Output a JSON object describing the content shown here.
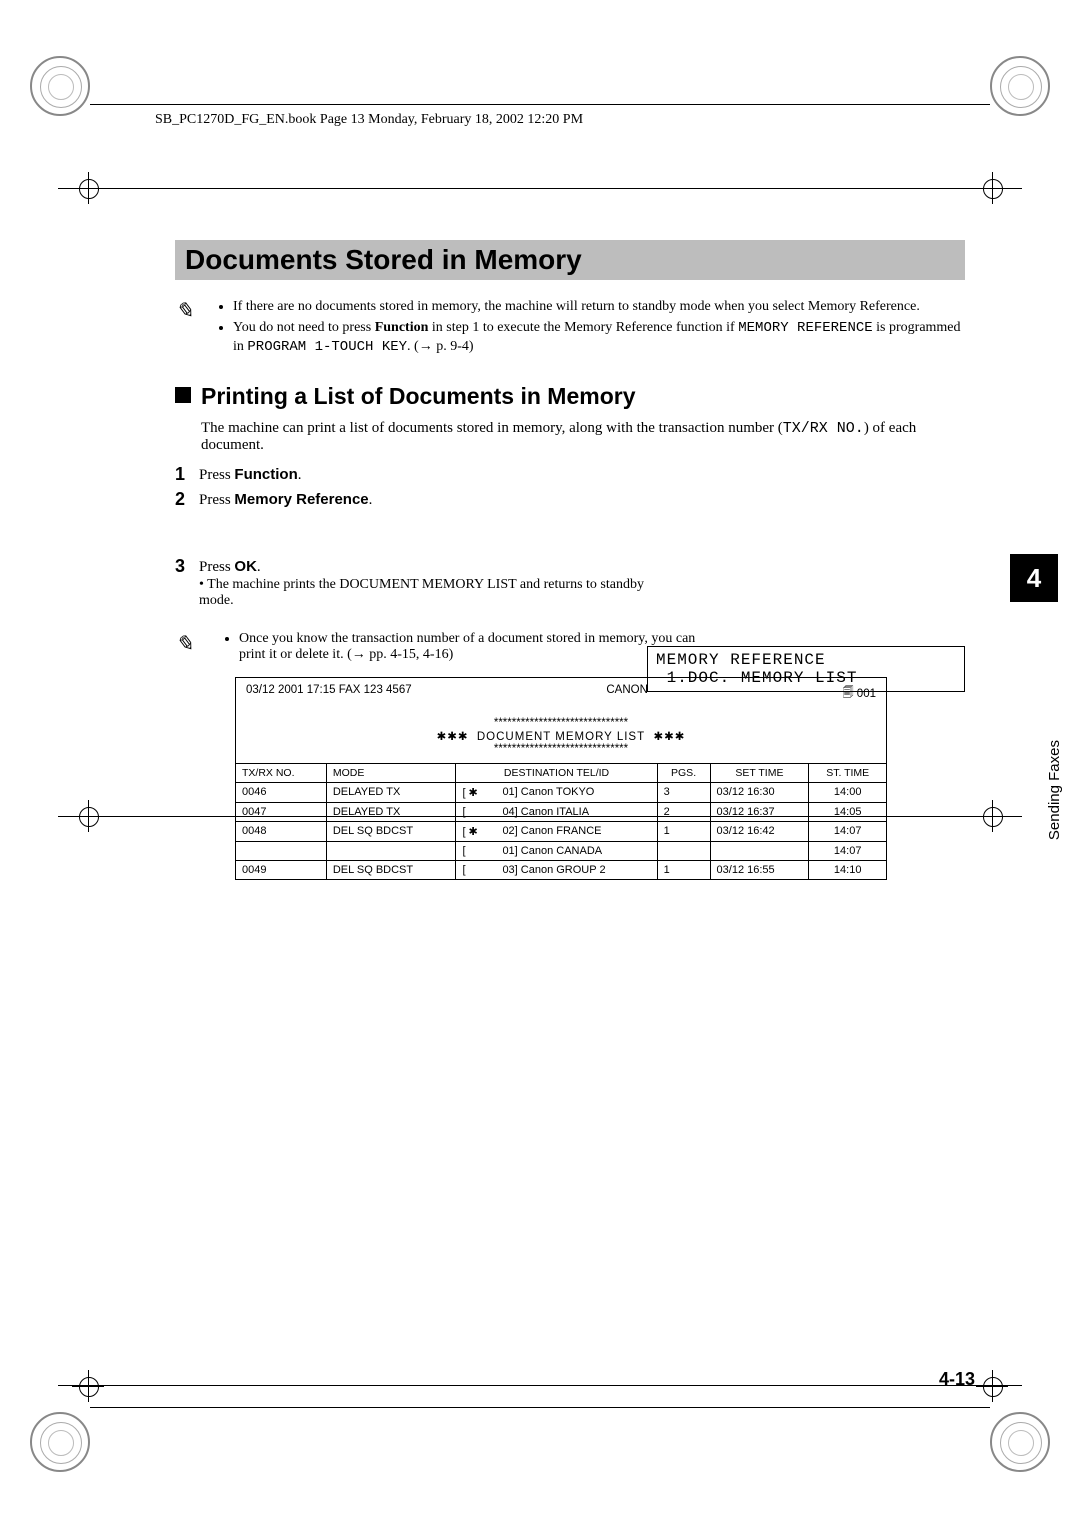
{
  "header_filename": "SB_PC1270D_FG_EN.book  Page 13  Monday, February 18, 2002  12:20 PM",
  "title": "Documents Stored in Memory",
  "notes_top": {
    "items": [
      {
        "pre": "If there are no documents stored in memory, the machine will return to standby mode when you select Memory Reference."
      },
      {
        "pre": "You do not need to press ",
        "bold": "Function",
        "post": " in step 1 to execute the Memory Reference function if ",
        "mono": "MEMORY REFERENCE",
        "post2": " is programmed in "
      },
      {
        "indent": true,
        "mono": "PROGRAM 1-TOUCH KEY",
        "post": ". (→ p. 9-4)"
      }
    ]
  },
  "section2": "Printing a List of Documents in Memory",
  "section2_body_pre": "The machine can print a list of documents stored in memory, along with the transaction number (",
  "section2_body_mono": "TX/RX NO.",
  "section2_body_post": ") of each document.",
  "steps": [
    {
      "n": "1",
      "pre": "Press ",
      "bold": "Function",
      "post": "."
    },
    {
      "n": "2",
      "pre": "Press ",
      "bold": "Memory Reference",
      "post": "."
    },
    {
      "n": "3",
      "pre": "Press ",
      "bold": "OK",
      "post": "."
    }
  ],
  "step3_sub": "The machine prints the DOCUMENT MEMORY LIST and returns to standby mode.",
  "lcd_line1": "MEMORY REFERENCE",
  "lcd_line2": " 1.DOC. MEMORY LIST",
  "note_bottom": "Once you know the transaction number of a document stored in memory, you can print it or delete it. (→ pp. 4-15, 4-16)",
  "report": {
    "header_left": "03/12 2001 17:15 FAX 123 4567",
    "header_center": "CANON",
    "header_right": "001",
    "ast_line": "******************************",
    "title": "DOCUMENT MEMORY LIST",
    "columns": [
      "TX/RX NO.",
      "MODE",
      "",
      "DESTINATION TEL/ID",
      "PGS.",
      "SET TIME",
      "ST. TIME"
    ],
    "rows": [
      {
        "txrx": "0046",
        "mode": "DELAYED TX",
        "mark": "[ ✱",
        "dest": "01] Canon TOKYO",
        "pgs": "3",
        "set": "03/12 16:30",
        "st": "14:00"
      },
      {
        "txrx": "0047",
        "mode": "DELAYED TX",
        "mark": "[",
        "dest": "04] Canon ITALIA",
        "pgs": "2",
        "set": "03/12 16:37",
        "st": "14:05"
      },
      {
        "txrx": "0048",
        "mode": "DEL SQ BDCST",
        "mark": "[ ✱",
        "dest": "02] Canon FRANCE",
        "pgs": "1",
        "set": "03/12 16:42",
        "st": "14:07"
      },
      {
        "txrx": "",
        "mode": "",
        "mark": "[",
        "dest": "01] Canon CANADA",
        "pgs": "",
        "set": "",
        "st": "14:07"
      },
      {
        "txrx": "0049",
        "mode": "DEL SQ BDCST",
        "mark": "[",
        "dest": "03] Canon GROUP 2",
        "pgs": "1",
        "set": "03/12 16:55",
        "st": "14:10"
      }
    ]
  },
  "side_tab": "4",
  "side_label": "Sending Faxes",
  "page_number": "4-13"
}
